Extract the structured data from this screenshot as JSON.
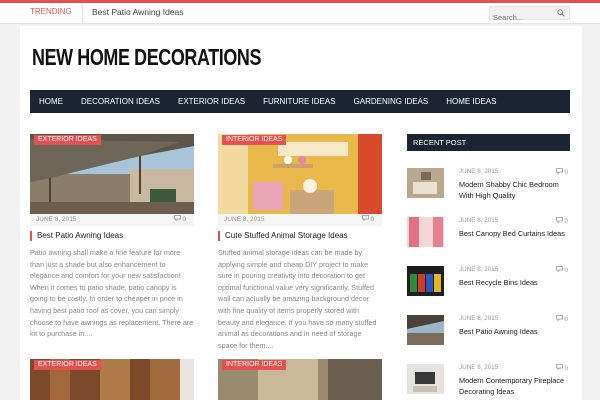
{
  "topbar": {
    "trending_label": "TRENDING",
    "trending_link": "Best Patio Awning Ideas",
    "search_placeholder": "Search..."
  },
  "site": {
    "logo": "NEW HOME DECORATIONS"
  },
  "nav": {
    "items": [
      "HOME",
      "DECORATION IDEAS",
      "EXTERIOR IDEAS",
      "FURNITURE IDEAS",
      "GARDENING IDEAS",
      "HOME IDEAS"
    ]
  },
  "cards": [
    {
      "badge": "EXTERIOR IDEAS",
      "date": "JUNE 8, 2015",
      "comments": "0",
      "title": "Best Patio Awning Ideas",
      "excerpt": "Patio awning shall make a fine feature for more than just a shade but also enhancement to elegance and comfort for your new satisfaction! When it comes to patio shade, patio canopy is going to be costly. In order to cheaper in price in having best patio roof as cover, you can simply choose to have awnings as replacement. There are kit to purchase in...."
    },
    {
      "badge": "INTERIOR IDEAS",
      "date": "JUNE 8, 2015",
      "comments": "0",
      "title": "Cute Stuffed Animal Storage Ideas",
      "excerpt": "Stuffed animal storage ideas can be made by applying simple and cheap DIY project to make sure in pouring creativity into decoration to get optimal functional value very significantly. Stuffed wall can actually be amazing background decor with fine quality of items properly stored with beauty and elegance. If you have so many stuffed animal as decorations and in need of storage space for them...."
    },
    {
      "badge": "EXTERIOR IDEAS"
    },
    {
      "badge": "INTERIOR IDEAS"
    }
  ],
  "sidebar": {
    "heading": "RECENT POST",
    "posts": [
      {
        "date": "JUNE 8, 2015",
        "comments": "0",
        "title": "Modern Shabby Chic Bedroom With High Quality"
      },
      {
        "date": "JUNE 8, 2015",
        "comments": "0",
        "title": "Best Canopy Bed Curtains Ideas"
      },
      {
        "date": "JUNE 8, 2015",
        "comments": "0",
        "title": "Best Recycle Bins Ideas"
      },
      {
        "date": "JUNE 8, 2015",
        "comments": "0",
        "title": "Best Patio Awning Ideas"
      },
      {
        "date": "JUNE 8, 2015",
        "comments": "0",
        "title": "Modern Contemporary Fireplace Decorating Ideas"
      }
    ]
  },
  "icons": {
    "search": "search-icon",
    "comment": "comment-icon"
  },
  "colors": {
    "accent": "#e55050",
    "nav_bg": "#1c2331"
  }
}
